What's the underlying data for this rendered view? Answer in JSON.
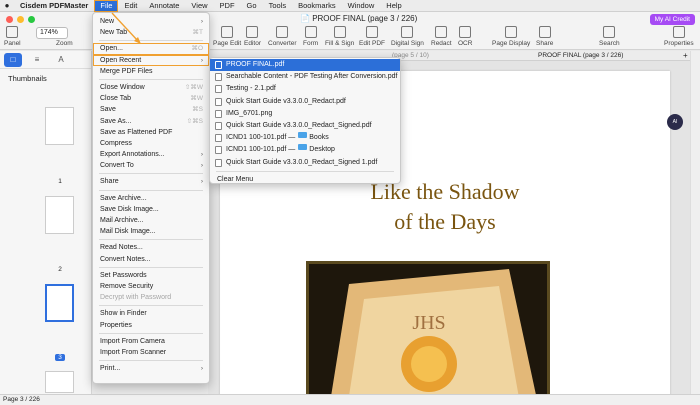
{
  "menubar": {
    "apple": "",
    "items": [
      "Cisdem PDFMaster",
      "File",
      "Edit",
      "Annotate",
      "View",
      "PDF",
      "Go",
      "Tools",
      "Bookmarks",
      "Window",
      "Help"
    ]
  },
  "toolbar": {
    "title": "PROOF FINAL (page 3 / 226)",
    "zoom_value": "174%",
    "panel_label": "Panel",
    "zoom_label": "Zoom",
    "tools": [
      "Page Edit",
      "Editor",
      "Converter",
      "Form",
      "Fill & Sign",
      "Edit PDF",
      "Digital Sign",
      "Redact",
      "OCR",
      "Page Display",
      "Share",
      "Search",
      "Properties"
    ],
    "ai_credit": "My AI Credit"
  },
  "tabs": {
    "page_indicator": "(page 5 / 10)",
    "right_tab": "PROOF FINAL (page 3 / 226)"
  },
  "sidebar": {
    "label": "Thumbnails",
    "thumb_numbers": [
      "1",
      "2",
      "3"
    ]
  },
  "file_menu": {
    "items": [
      {
        "label": "New",
        "shortcut": "",
        "submenu": true
      },
      {
        "label": "New Tab",
        "shortcut": "⌘T"
      },
      {
        "sep": true
      },
      {
        "label": "Open...",
        "shortcut": "⌘O"
      },
      {
        "label": "Open Recent",
        "shortcut": "",
        "submenu": true
      },
      {
        "label": "Merge PDF Files",
        "shortcut": ""
      },
      {
        "sep": true
      },
      {
        "label": "Close Window",
        "shortcut": "⇧⌘W"
      },
      {
        "label": "Close Tab",
        "shortcut": "⌘W"
      },
      {
        "label": "Save",
        "shortcut": "⌘S"
      },
      {
        "label": "Save As...",
        "shortcut": "⇧⌘S"
      },
      {
        "label": "Save as Flattened PDF",
        "shortcut": ""
      },
      {
        "label": "Compress",
        "shortcut": ""
      },
      {
        "label": "Export Annotations...",
        "shortcut": "",
        "submenu": true
      },
      {
        "label": "Convert To",
        "shortcut": "",
        "submenu": true
      },
      {
        "sep": true
      },
      {
        "label": "Share",
        "shortcut": "",
        "submenu": true
      },
      {
        "sep": true
      },
      {
        "label": "Save Archive...",
        "shortcut": ""
      },
      {
        "label": "Save Disk Image...",
        "shortcut": ""
      },
      {
        "label": "Mail Archive...",
        "shortcut": ""
      },
      {
        "label": "Mail Disk Image...",
        "shortcut": ""
      },
      {
        "sep": true
      },
      {
        "label": "Read Notes...",
        "shortcut": ""
      },
      {
        "label": "Convert Notes...",
        "shortcut": ""
      },
      {
        "sep": true
      },
      {
        "label": "Set Passwords",
        "shortcut": ""
      },
      {
        "label": "Remove Security",
        "shortcut": ""
      },
      {
        "label": "Decrypt with Password",
        "shortcut": "",
        "disabled": true
      },
      {
        "sep": true
      },
      {
        "label": "Show in Finder",
        "shortcut": ""
      },
      {
        "label": "Properties",
        "shortcut": ""
      },
      {
        "sep": true
      },
      {
        "label": "Import From Camera",
        "shortcut": ""
      },
      {
        "label": "Import From Scanner",
        "shortcut": ""
      },
      {
        "sep": true
      },
      {
        "label": "Print...",
        "shortcut": "",
        "submenu": true
      }
    ]
  },
  "recent_menu": {
    "items": [
      {
        "label": "PROOF FINAL.pdf"
      },
      {
        "label": "Searchable Content - PDF Testing After Conversion.pdf"
      },
      {
        "label": "Testing - 2.1.pdf"
      },
      {
        "label": "Quick Start Guide v3.3.0.0_Redact.pdf"
      },
      {
        "label": "IMG_6701.png"
      },
      {
        "label": "Quick Start Guide v3.3.0.0_Redact_Signed.pdf"
      },
      {
        "label": "ICND1 100-101.pdf —",
        "folder": "Books"
      },
      {
        "label": "ICND1 100-101.pdf —",
        "folder": "Desktop"
      },
      {
        "label": "Quick Start Guide v3.3.0.0_Redact_Signed 1.pdf"
      },
      {
        "sep": true
      },
      {
        "label": "Clear Menu"
      }
    ]
  },
  "document": {
    "heading_line1": "Like the Shadow",
    "heading_line2": "of the Days"
  },
  "status": {
    "page_text": "Page 3 / 226"
  },
  "ai_bubble": "AI",
  "colors": {
    "accent": "#2c6fd8",
    "highlight": "#f0a030",
    "ai": "#a64bf4"
  }
}
